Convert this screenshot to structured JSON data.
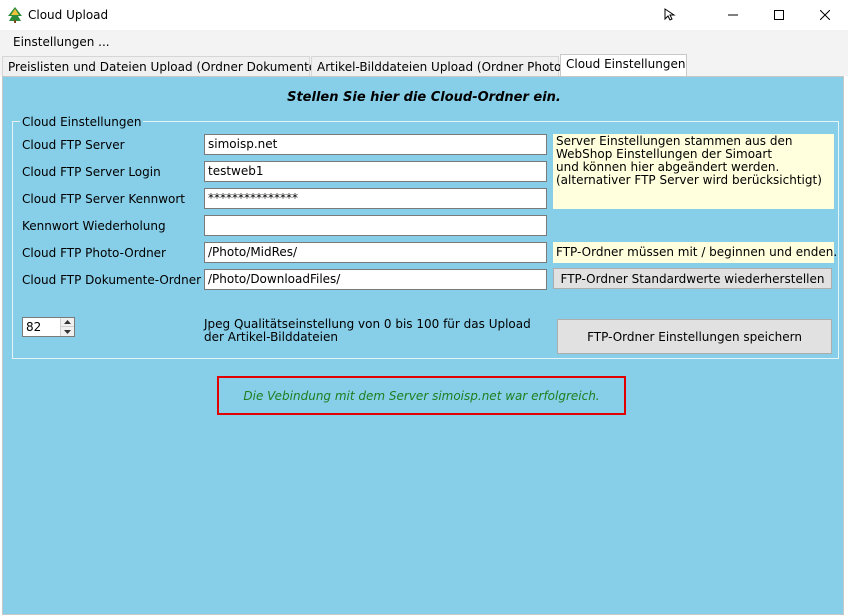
{
  "window": {
    "title": "Cloud Upload",
    "icons": {
      "app": "tree-icon",
      "cursor": "cursor-icon",
      "minimize": "minimize-icon",
      "maximize": "maximize-icon",
      "close": "close-icon"
    }
  },
  "menu": {
    "items": [
      {
        "label": "Einstellungen ..."
      }
    ]
  },
  "tabs": [
    {
      "label": "Preislisten und Dateien Upload (Ordner Dokumente)",
      "active": false
    },
    {
      "label": "Artikel-Bilddateien Upload (Ordner Photo)",
      "active": false
    },
    {
      "label": "Cloud Einstellungen",
      "active": true
    }
  ],
  "content": {
    "heading": "Stellen Sie hier die Cloud-Ordner ein.",
    "group_title": "Cloud Einstellungen",
    "fields": [
      {
        "label": "Cloud FTP Server",
        "value": "simoisp.net"
      },
      {
        "label": "Cloud FTP Server Login",
        "value": "testweb1"
      },
      {
        "label": "Cloud FTP Server Kennwort",
        "value": "***************"
      },
      {
        "label": "Kennwort Wiederholung",
        "value": ""
      },
      {
        "label": "Cloud FTP Photo-Ordner",
        "value": "/Photo/MidRes/"
      },
      {
        "label": "Cloud FTP Dokumente-Ordner",
        "value": "/Photo/DownloadFiles/"
      }
    ],
    "server_note": "Server Einstellungen stammen aus den\nWebShop Einstellungen der Simoart\nund können hier abgeändert werden.\n(alternativer FTP Server wird berücksichtigt)",
    "folder_note": "FTP-Ordner müssen mit / beginnen und enden.",
    "restore_button": "FTP-Ordner Standardwerte wiederherstellen",
    "jpeg_quality": "82",
    "jpeg_desc": "Jpeg Qualitätseinstellung von 0 bis 100 für das Upload\nder Artikel-Bilddateien",
    "save_button": "FTP-Ordner Einstellungen speichern",
    "status_message": "Die Vebindung mit dem Server simoisp.net war erfolgreich."
  },
  "colors": {
    "panel": "#87cee8",
    "note": "#ffffdd",
    "status_border": "#e00000",
    "status_text": "#1f7f1f"
  }
}
